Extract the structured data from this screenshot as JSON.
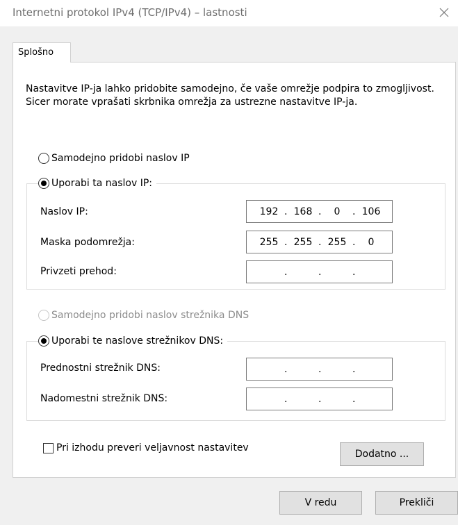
{
  "window": {
    "title": "Internetni protokol IPv4 (TCP/IPv4) – lastnosti",
    "close_icon": "close-icon"
  },
  "tabs": {
    "general": "Splošno"
  },
  "description": "Nastavitve IP-ja lahko pridobite samodejno, če vaše omrežje podpira to zmogljivost. Sicer morate vprašati skrbnika omrežja za ustrezne nastavitve IP-ja.",
  "ip_section": {
    "auto_label": "Samodejno pridobi naslov IP",
    "manual_label": "Uporabi ta naslov IP:",
    "selected": "manual",
    "fields": [
      {
        "label": "Naslov IP:",
        "octets": [
          "192",
          "168",
          "0",
          "106"
        ]
      },
      {
        "label": "Maska podomrežja:",
        "octets": [
          "255",
          "255",
          "255",
          "0"
        ]
      },
      {
        "label": "Privzeti prehod:",
        "octets": [
          "",
          "",
          "",
          ""
        ]
      }
    ]
  },
  "dns_section": {
    "auto_label": "Samodejno pridobi naslov strežnika DNS",
    "manual_label": "Uporabi te naslove strežnikov DNS:",
    "selected": "manual",
    "fields": [
      {
        "label": "Prednostni strežnik DNS:",
        "octets": [
          "",
          "",
          "",
          ""
        ]
      },
      {
        "label": "Nadomestni strežnik DNS:",
        "octets": [
          "",
          "",
          "",
          ""
        ]
      }
    ]
  },
  "validate_on_exit": {
    "label": "Pri izhodu preveri veljavnost nastavitev",
    "checked": false
  },
  "buttons": {
    "advanced": "Dodatno ...",
    "ok": "V redu",
    "cancel": "Prekliči"
  },
  "colors": {
    "window_background": "#f0f0f0",
    "title_text": "#6e6e6e",
    "disabled_text": "#8c8c8c",
    "button_background": "#e1e1e1"
  }
}
